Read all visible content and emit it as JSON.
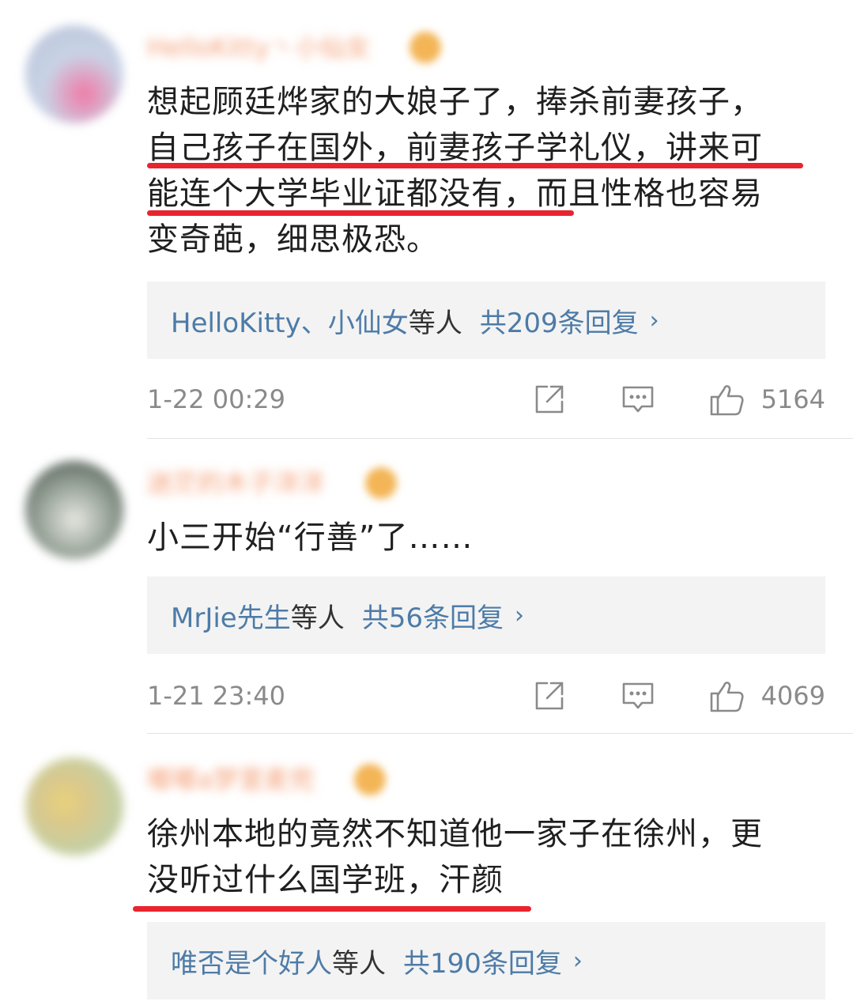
{
  "comments": [
    {
      "text_lines": [
        "想起顾廷烨家的大娘子了，捧杀前妻孩子，",
        "自己孩子在国外，前妻孩子学礼仪，讲来可",
        "能连个大学毕业证都没有，而且性格也容易",
        "变奇葩，细思极恐。"
      ],
      "replies": {
        "names": "HelloKitty、小仙女",
        "etc": "等人",
        "count": "共209条回复",
        "chevron": "›"
      },
      "timestamp": "1-22 00:29",
      "likes": "5164",
      "username": "HelloKitty丶小仙女"
    },
    {
      "text_lines": [
        "小三开始“行善”了……"
      ],
      "replies": {
        "names": "MrJie先生",
        "etc": "等人",
        "count": "共56条回复",
        "chevron": "›"
      },
      "timestamp": "1-21 23:40",
      "likes": "4069",
      "username": "迷茫的木子洋洋"
    },
    {
      "text_lines": [
        "徐州本地的竟然不知道他一家子在徐州，更",
        "没听过什么国学班，汗颜"
      ],
      "replies": {
        "names": "唯否是个好人",
        "etc": "等人",
        "count": "共190条回复",
        "chevron": "›"
      },
      "username": "嘟嘟a梦里麦兜"
    }
  ],
  "colors": {
    "link": "#4d7ba7",
    "underline": "#e8242f",
    "reply_bg": "#f3f3f3",
    "meta_text": "#8a8a8a"
  },
  "icons": [
    "share-icon",
    "comment-icon",
    "like-icon"
  ]
}
